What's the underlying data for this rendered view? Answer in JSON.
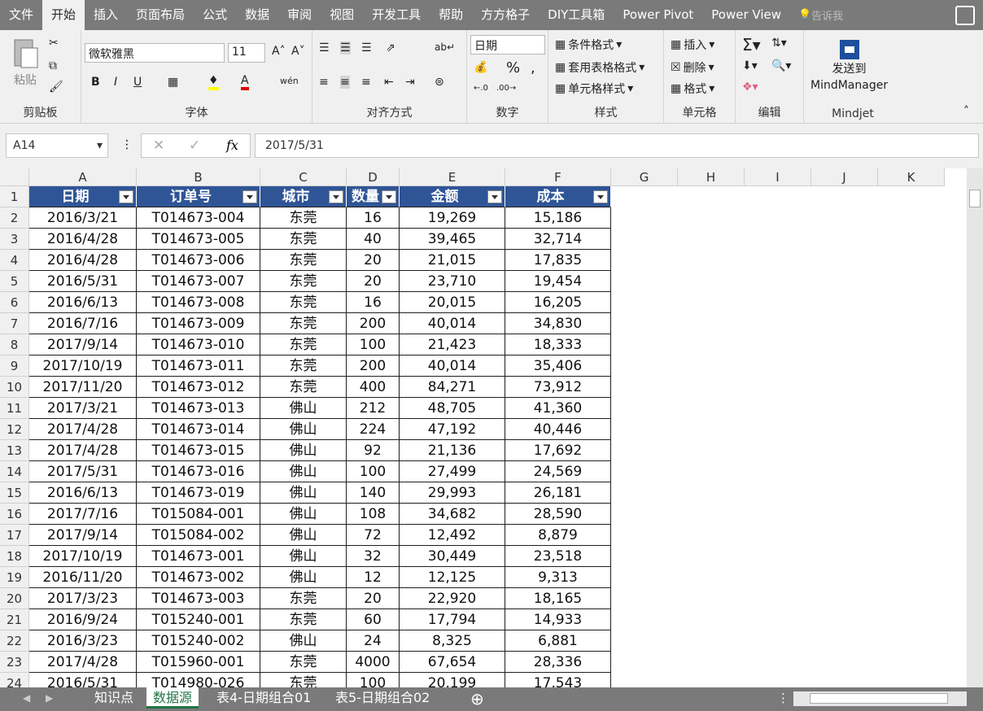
{
  "ribbon_tabs": [
    "文件",
    "开始",
    "插入",
    "页面布局",
    "公式",
    "数据",
    "审阅",
    "视图",
    "开发工具",
    "帮助",
    "方方格子",
    "DIY工具箱",
    "Power Pivot",
    "Power View"
  ],
  "tell_me": "告诉我",
  "font": {
    "name": "微软雅黑",
    "size": "11"
  },
  "number_format": "日期",
  "groups": {
    "clipboard": "剪贴板",
    "font": "字体",
    "alignment": "对齐方式",
    "number": "数字",
    "styles": "样式",
    "cells": "单元格",
    "editing": "编辑",
    "mindjet": "Mindjet"
  },
  "buttons": {
    "paste": "粘贴",
    "cond_format": "条件格式",
    "table_format": "套用表格格式",
    "cell_style": "单元格样式",
    "insert": "插入",
    "delete": "删除",
    "format": "格式",
    "send_to": "发送到",
    "mindmanager": "MindManager",
    "bold": "B",
    "italic": "I",
    "underline": "U",
    "percent": "%",
    "comma": ","
  },
  "name_box": "A14",
  "formula": "2017/5/31",
  "columns": [
    "A",
    "B",
    "C",
    "D",
    "E",
    "F",
    "G",
    "H",
    "I",
    "J",
    "K"
  ],
  "headers": [
    "日期",
    "订单号",
    "城市",
    "数量",
    "金额",
    "成本"
  ],
  "rows": [
    [
      "2016/3/21",
      "T014673-004",
      "东莞",
      "16",
      "19,269",
      "15,186"
    ],
    [
      "2016/4/28",
      "T014673-005",
      "东莞",
      "40",
      "39,465",
      "32,714"
    ],
    [
      "2016/4/28",
      "T014673-006",
      "东莞",
      "20",
      "21,015",
      "17,835"
    ],
    [
      "2016/5/31",
      "T014673-007",
      "东莞",
      "20",
      "23,710",
      "19,454"
    ],
    [
      "2016/6/13",
      "T014673-008",
      "东莞",
      "16",
      "20,015",
      "16,205"
    ],
    [
      "2016/7/16",
      "T014673-009",
      "东莞",
      "200",
      "40,014",
      "34,830"
    ],
    [
      "2017/9/14",
      "T014673-010",
      "东莞",
      "100",
      "21,423",
      "18,333"
    ],
    [
      "2017/10/19",
      "T014673-011",
      "东莞",
      "200",
      "40,014",
      "35,406"
    ],
    [
      "2017/11/20",
      "T014673-012",
      "东莞",
      "400",
      "84,271",
      "73,912"
    ],
    [
      "2017/3/21",
      "T014673-013",
      "佛山",
      "212",
      "48,705",
      "41,360"
    ],
    [
      "2017/4/28",
      "T014673-014",
      "佛山",
      "224",
      "47,192",
      "40,446"
    ],
    [
      "2017/4/28",
      "T014673-015",
      "佛山",
      "92",
      "21,136",
      "17,692"
    ],
    [
      "2017/5/31",
      "T014673-016",
      "佛山",
      "100",
      "27,499",
      "24,569"
    ],
    [
      "2016/6/13",
      "T014673-019",
      "佛山",
      "140",
      "29,993",
      "26,181"
    ],
    [
      "2017/7/16",
      "T015084-001",
      "佛山",
      "108",
      "34,682",
      "28,590"
    ],
    [
      "2017/9/14",
      "T015084-002",
      "佛山",
      "72",
      "12,492",
      "8,879"
    ],
    [
      "2017/10/19",
      "T014673-001",
      "佛山",
      "32",
      "30,449",
      "23,518"
    ],
    [
      "2016/11/20",
      "T014673-002",
      "佛山",
      "12",
      "12,125",
      "9,313"
    ],
    [
      "2017/3/23",
      "T014673-003",
      "东莞",
      "20",
      "22,920",
      "18,165"
    ],
    [
      "2016/9/24",
      "T015240-001",
      "东莞",
      "60",
      "17,794",
      "14,933"
    ],
    [
      "2016/3/23",
      "T015240-002",
      "佛山",
      "24",
      "8,325",
      "6,881"
    ],
    [
      "2017/4/28",
      "T015960-001",
      "东莞",
      "4000",
      "67,654",
      "28,336"
    ],
    [
      "2016/5/31",
      "T014980-026",
      "东莞",
      "100",
      "20,199",
      "17,543"
    ]
  ],
  "sheet_tabs": [
    "知识点",
    "数据源",
    "表4-日期组合01",
    "表5-日期组合02"
  ],
  "active_sheet": "数据源",
  "colors": {
    "header_fill": "#2f5597",
    "ribbon_tab_bar": "#7a7a7a",
    "active_sheet": "#217346"
  }
}
